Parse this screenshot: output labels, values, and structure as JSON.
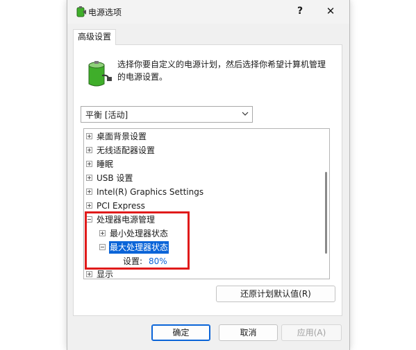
{
  "window": {
    "title": "电源选项",
    "help_label": "?",
    "close_label": "✕"
  },
  "tab": {
    "label": "高级设置"
  },
  "description": "选择你要自定义的电源计划，然后选择你希望计算机管理的电源设置。",
  "plan_select": {
    "value": "平衡 [活动]"
  },
  "tree": {
    "items": [
      {
        "label": "桌面背景设置",
        "state": "collapsed"
      },
      {
        "label": "无线适配器设置",
        "state": "collapsed"
      },
      {
        "label": "睡眠",
        "state": "collapsed"
      },
      {
        "label": "USB 设置",
        "state": "collapsed"
      },
      {
        "label": "Intel(R) Graphics Settings",
        "state": "collapsed"
      },
      {
        "label": "PCI Express",
        "state": "collapsed"
      },
      {
        "label": "处理器电源管理",
        "state": "expanded"
      },
      {
        "label": "最小处理器状态",
        "state": "collapsed"
      },
      {
        "label": "最大处理器状态",
        "state": "expanded",
        "selected": true
      },
      {
        "label": "设置:",
        "value": "80%"
      },
      {
        "label": "显示",
        "state": "collapsed"
      }
    ]
  },
  "buttons": {
    "restore": "还原计划默认值(R)",
    "ok": "确定",
    "cancel": "取消",
    "apply": "应用(A)"
  },
  "colors": {
    "accent": "#0a64d8",
    "highlight_box": "#e01a1a",
    "battery_green": "#3fae2a"
  }
}
